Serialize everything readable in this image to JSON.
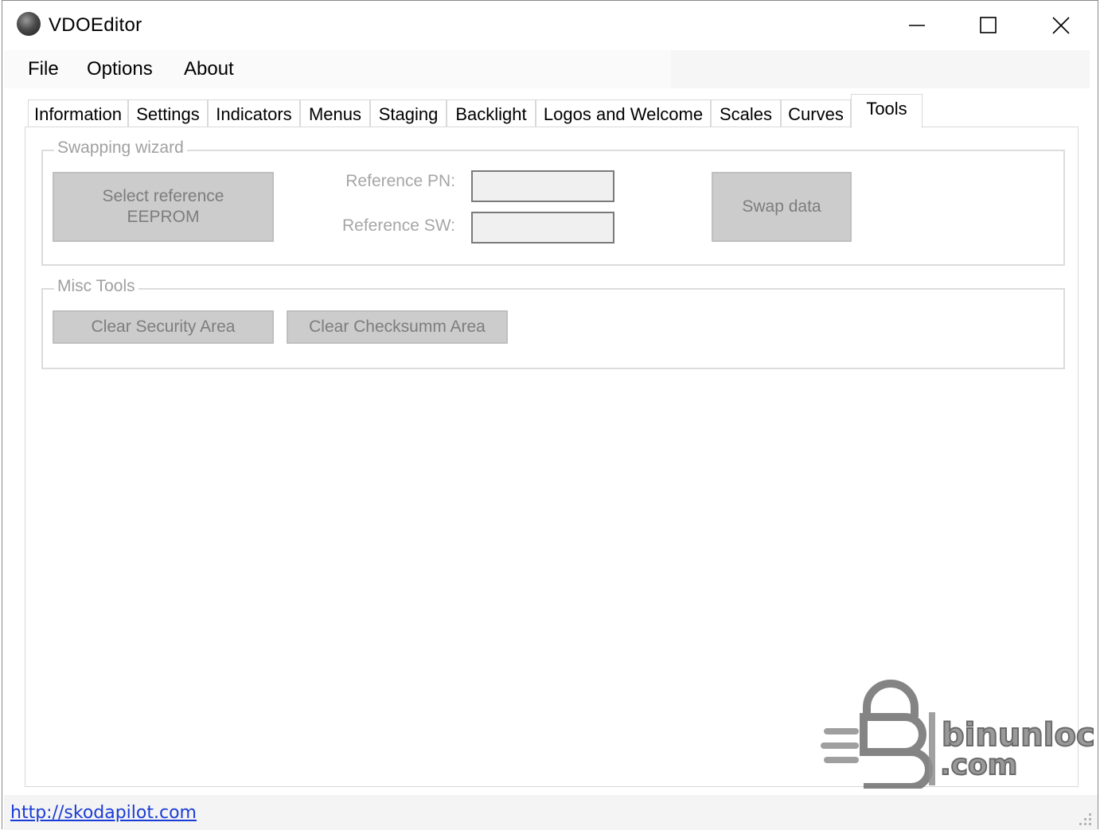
{
  "window": {
    "title": "VDOEditor"
  },
  "menu": {
    "items": [
      "File",
      "Options",
      "About"
    ]
  },
  "tabs": [
    {
      "label": "Information"
    },
    {
      "label": "Settings"
    },
    {
      "label": "Indicators"
    },
    {
      "label": "Menus"
    },
    {
      "label": "Staging"
    },
    {
      "label": "Backlight"
    },
    {
      "label": "Logos and Welcome"
    },
    {
      "label": "Scales"
    },
    {
      "label": "Curves"
    },
    {
      "label": "Tools",
      "active": true
    }
  ],
  "swapping_wizard": {
    "legend": "Swapping wizard",
    "select_button_line1": "Select reference",
    "select_button_line2": "EEPROM",
    "reference_pn_label": "Reference PN:",
    "reference_pn_value": "",
    "reference_sw_label": "Reference SW:",
    "reference_sw_value": "",
    "swap_button": "Swap data"
  },
  "misc_tools": {
    "legend": "Misc Tools",
    "clear_security_button": "Clear Security Area",
    "clear_checksum_button": "Clear Checksumm Area"
  },
  "status": {
    "link": "http://skodapilot.com"
  },
  "watermark": {
    "line1": "binunlock",
    "line2": ".com"
  },
  "colors": {
    "disabled_text": "#a0a0a0",
    "button_face": "#cccccc",
    "link": "#1a3cd6"
  }
}
